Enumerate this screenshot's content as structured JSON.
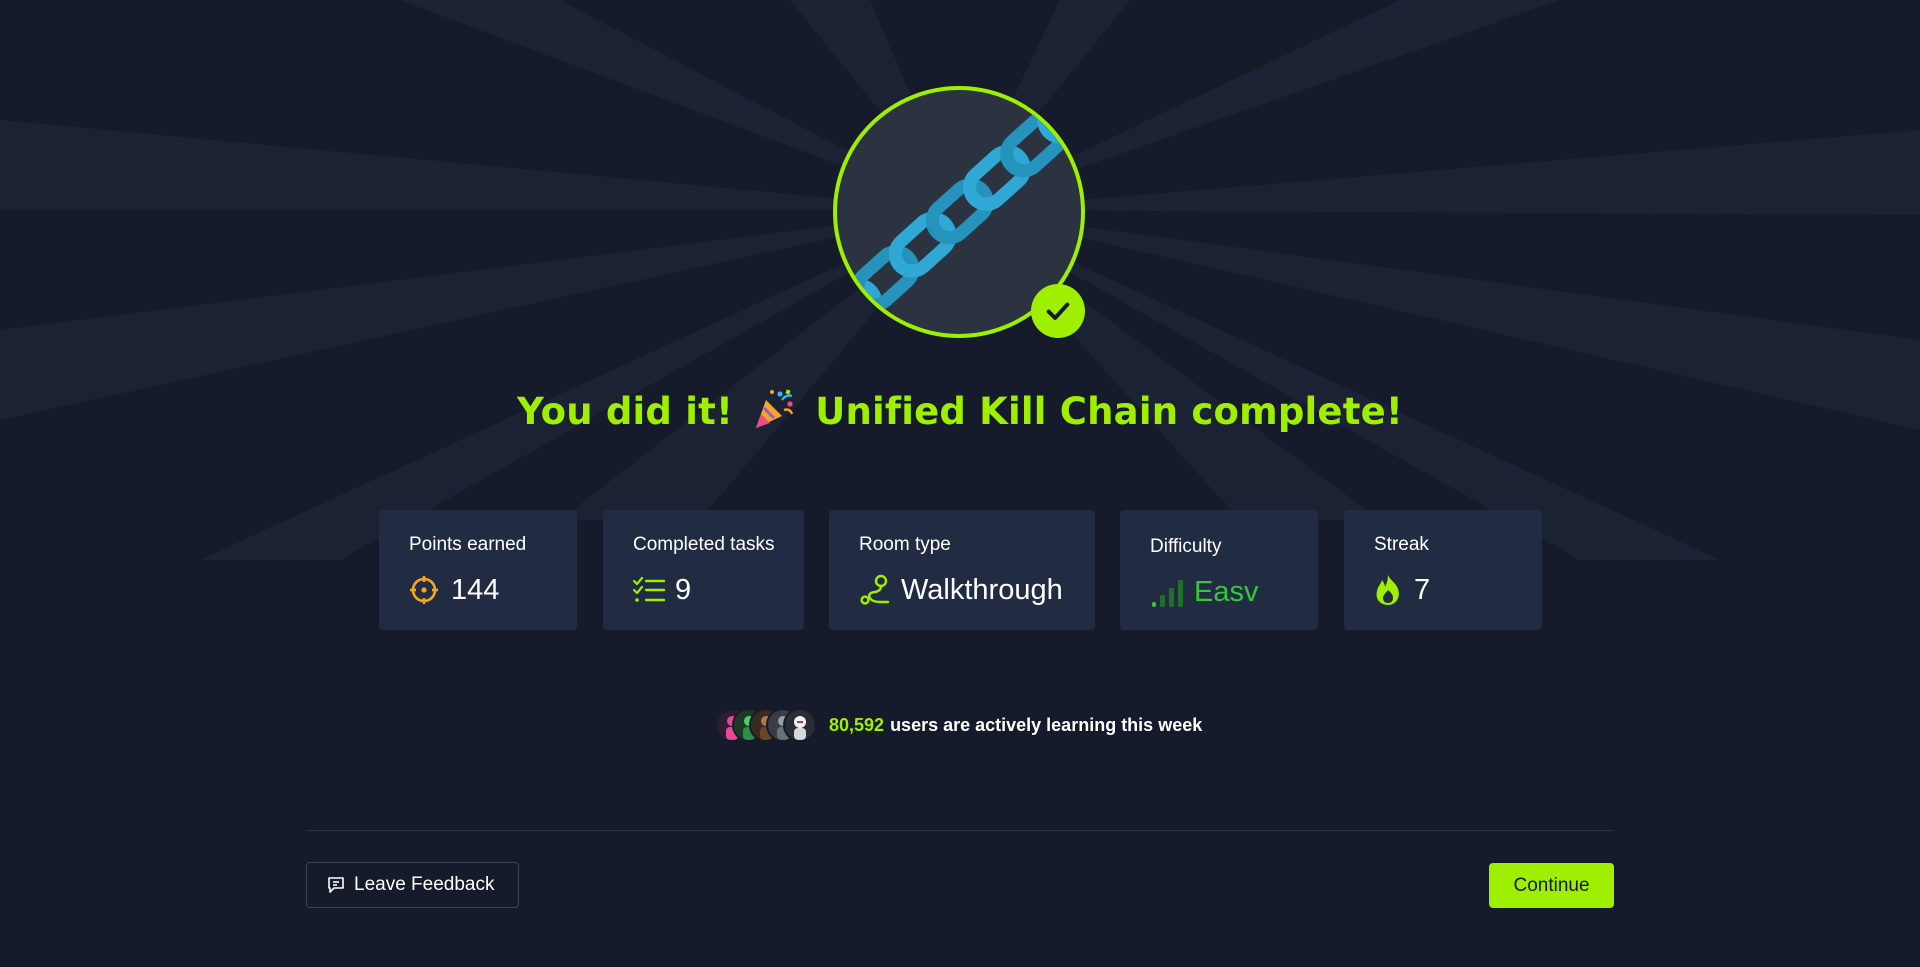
{
  "completion": {
    "prefix": "You did it!",
    "celebration_icon": "party-popper-icon",
    "suffix": "Unified Kill Chain complete!",
    "room_badge_icon": "chain-icon",
    "check_icon": "checkmark-icon"
  },
  "stats": [
    {
      "label": "Points earned",
      "value": "144",
      "icon": "target-icon"
    },
    {
      "label": "Completed tasks",
      "value": "9",
      "icon": "checklist-icon"
    },
    {
      "label": "Room type",
      "value": "Walkthrough",
      "icon": "route-icon"
    },
    {
      "label": "Difficulty",
      "value": "Easv",
      "icon": "signal-bars-icon"
    },
    {
      "label": "Streak",
      "value": "7",
      "icon": "flame-icon"
    }
  ],
  "learners": {
    "count": "80,592",
    "text": "users are actively learning this week"
  },
  "actions": {
    "feedback_label": "Leave Feedback",
    "feedback_icon": "feedback-icon",
    "continue_label": "Continue"
  },
  "colors": {
    "background": "#151b2a",
    "accent": "#9fef00",
    "card": "#212c42",
    "difficulty": "#36c63c",
    "points_icon": "#f5a623",
    "chain": "#2fa8d5"
  }
}
